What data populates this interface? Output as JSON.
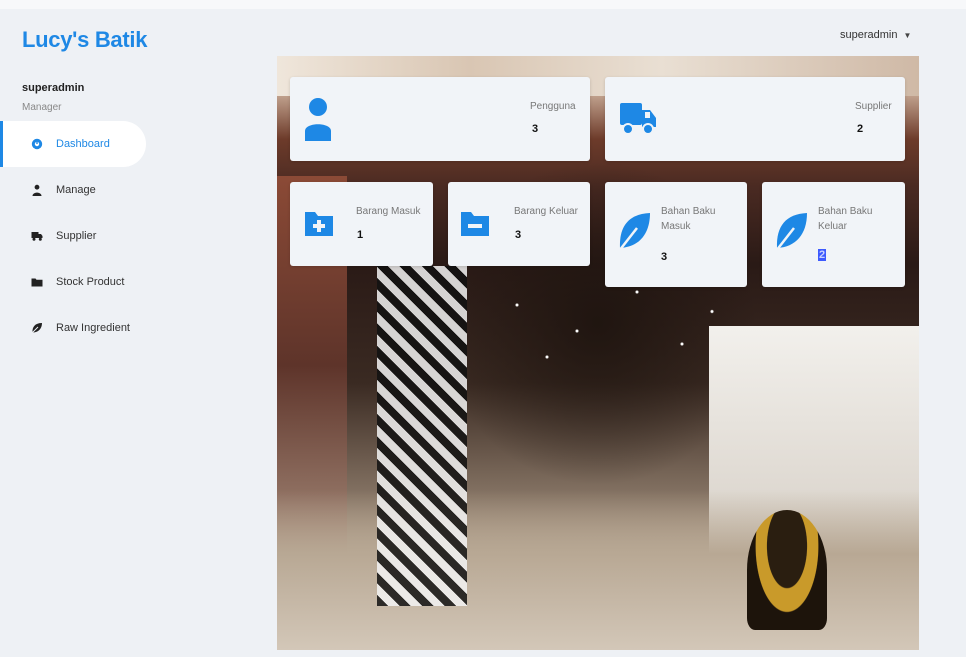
{
  "app": {
    "brand": "Lucy's Batik",
    "user_menu": "superadmin"
  },
  "sidebar": {
    "profile_name": "superadmin",
    "profile_role": "Manager",
    "items": [
      {
        "label": "Dashboard",
        "icon": "dashboard-icon",
        "active": true
      },
      {
        "label": "Manage",
        "icon": "user-icon",
        "active": false
      },
      {
        "label": "Supplier",
        "icon": "truck-icon",
        "active": false
      },
      {
        "label": "Stock Product",
        "icon": "folder-icon",
        "active": false
      },
      {
        "label": "Raw Ingredient",
        "icon": "leaf-icon",
        "active": false
      }
    ]
  },
  "cards": {
    "pengguna": {
      "label": "Pengguna",
      "value": "3",
      "icon": "user-icon"
    },
    "supplier": {
      "label": "Supplier",
      "value": "2",
      "icon": "truck-icon"
    },
    "barang_masuk": {
      "label": "Barang Masuk",
      "value": "1",
      "icon": "folder-plus-icon"
    },
    "barang_keluar": {
      "label": "Barang Keluar",
      "value": "3",
      "icon": "folder-minus-icon"
    },
    "bahan_baku_masuk": {
      "label": "Bahan Baku Masuk",
      "value": "3",
      "icon": "leaf-icon"
    },
    "bahan_baku_keluar": {
      "label": "Bahan Baku Keluar",
      "value": "2",
      "icon": "leaf-icon"
    }
  },
  "colors": {
    "accent": "#1e88e5",
    "background": "#eef1f5",
    "card": "#f1f4f8"
  }
}
